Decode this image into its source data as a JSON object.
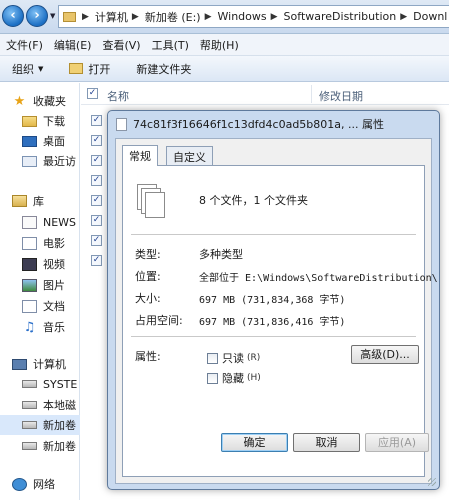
{
  "address": {
    "crumbs": [
      "计算机",
      "新加卷 (E:)",
      "Windows",
      "SoftwareDistribution",
      "Downl"
    ]
  },
  "menu": [
    "文件(F)",
    "编辑(E)",
    "查看(V)",
    "工具(T)",
    "帮助(H)"
  ],
  "toolbar": {
    "organize": "组织",
    "open": "打开",
    "new_folder": "新建文件夹"
  },
  "nav": {
    "favorites": "收藏夹",
    "downloads": "下载",
    "desktop": "桌面",
    "recent": "最近访",
    "libraries": "库",
    "news": "NEWS",
    "movies": "电影",
    "videos": "视频",
    "pictures": "图片",
    "documents": "文档",
    "music": "音乐",
    "computer": "计算机",
    "system_drive": "SYSTE",
    "local_disk": "本地磁",
    "volume_1": "新加卷",
    "volume_2": "新加卷",
    "network": "网络"
  },
  "file_list": {
    "col_name": "名称",
    "col_date": "修改日期",
    "checked_rows": 8
  },
  "dialog": {
    "title": "74c81f3f16646f1c13dfd4c0ad5b801a, ... 属性",
    "tabs": [
      "常规",
      "自定义"
    ],
    "summary": "8 个文件，1 个文件夹",
    "type_label": "类型:",
    "type_value": "多种类型",
    "location_label": "位置:",
    "location_value": "全部位于 E:\\Windows\\SoftwareDistribution\\",
    "size_label": "大小:",
    "size_value": "697 MB (731,834,368 字节)",
    "disk_size_label": "占用空间:",
    "disk_size_value": "697 MB (731,836,416 字节)",
    "attributes_label": "属性:",
    "readonly_label": "只读",
    "readonly_key": "(R)",
    "hidden_label": "隐藏",
    "hidden_key": "(H)",
    "advanced_button": "高级(D)...",
    "ok_button": "确定",
    "cancel_button": "取消",
    "apply_button": "应用(A)"
  }
}
